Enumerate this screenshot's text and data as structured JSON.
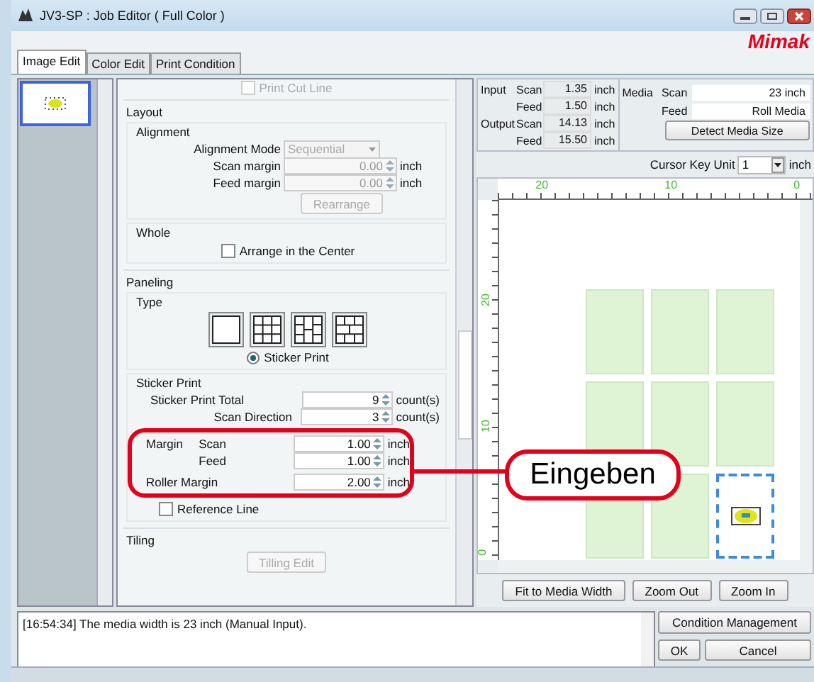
{
  "window": {
    "title": "JV3-SP : Job Editor ( Full Color )"
  },
  "logo": "Mimak",
  "tabs": [
    {
      "label": "Image Edit",
      "selected": true
    },
    {
      "label": "Color Edit",
      "selected": false
    },
    {
      "label": "Print Condition",
      "selected": false
    }
  ],
  "settings": {
    "print_cut_line": {
      "label": "Print Cut Line",
      "checked": false,
      "disabled": true
    },
    "layout": {
      "title": "Layout",
      "alignment": {
        "title": "Alignment",
        "mode": {
          "label": "Alignment Mode",
          "value": "Sequential",
          "disabled": true
        },
        "fields": [
          {
            "label": "Scan margin",
            "value": "0.00",
            "unit": "inch",
            "disabled": true
          },
          {
            "label": "Feed margin",
            "value": "0.00",
            "unit": "inch",
            "disabled": true
          }
        ],
        "button": {
          "label": "Rearrange",
          "disabled": true
        }
      }
    },
    "whole": {
      "title": "Whole",
      "checkbox": {
        "label": "Arrange in the Center",
        "checked": false
      }
    },
    "paneling": {
      "title": "Paneling",
      "type_title": "Type",
      "types": [
        {
          "kind": "single"
        },
        {
          "kind": "grid"
        },
        {
          "kind": "brick-vertical"
        },
        {
          "kind": "brick-horizontal"
        }
      ],
      "radio": {
        "label": "Sticker Print",
        "selected": true
      }
    },
    "sticker_print": {
      "title": "Sticker Print",
      "counts": [
        {
          "label": "Sticker Print Total",
          "value": "9",
          "unit": "count(s)"
        },
        {
          "label": "Scan Direction",
          "value": "3",
          "unit": "count(s)"
        }
      ],
      "margin": {
        "label": "Margin",
        "rows": [
          {
            "label": "Scan",
            "value": "1.00",
            "unit": "inch"
          },
          {
            "label": "Feed",
            "value": "1.00",
            "unit": "inch"
          }
        ]
      },
      "roller_margin": {
        "label": "Roller Margin",
        "value": "2.00",
        "unit": "inch"
      },
      "reference_line": {
        "label": "Reference Line",
        "checked": false
      }
    },
    "tiling": {
      "title": "Tiling",
      "button": {
        "label": "Tilling Edit",
        "disabled": true
      }
    }
  },
  "size_info": [
    {
      "label": "Input",
      "rows": [
        {
          "label": "Scan",
          "value": "1.35",
          "unit": "inch"
        },
        {
          "label": "Feed",
          "value": "1.50",
          "unit": "inch"
        }
      ]
    },
    {
      "label": "Output",
      "rows": [
        {
          "label": "Scan",
          "value": "14.13",
          "unit": "inch"
        },
        {
          "label": "Feed",
          "value": "15.50",
          "unit": "inch"
        }
      ]
    }
  ],
  "media": {
    "label": "Media",
    "rows": [
      {
        "label": "Scan",
        "value": "23 inch"
      },
      {
        "label": "Feed",
        "value": "Roll Media"
      }
    ],
    "button": "Detect Media Size"
  },
  "cursor_key_unit": {
    "label": "Cursor Key Unit",
    "value": "1",
    "unit": "inch"
  },
  "preview": {
    "top_ruler": [
      "20",
      "10",
      "0"
    ],
    "left_ruler": [
      "20",
      "10",
      "0"
    ],
    "stickers": [
      {
        "selected": false
      },
      {
        "selected": false
      },
      {
        "selected": false
      },
      {
        "selected": false
      },
      {
        "selected": false
      },
      {
        "selected": false
      },
      {
        "selected": false
      },
      {
        "selected": false
      },
      {
        "selected": true
      }
    ]
  },
  "preview_buttons": [
    "Fit to Media Width",
    "Zoom Out",
    "Zoom In"
  ],
  "log": "[16:54:34] The media width is 23 inch (Manual Input).",
  "buttons": [
    "Condition Management",
    "OK",
    "Cancel"
  ],
  "callout": {
    "label": "Eingeben"
  }
}
